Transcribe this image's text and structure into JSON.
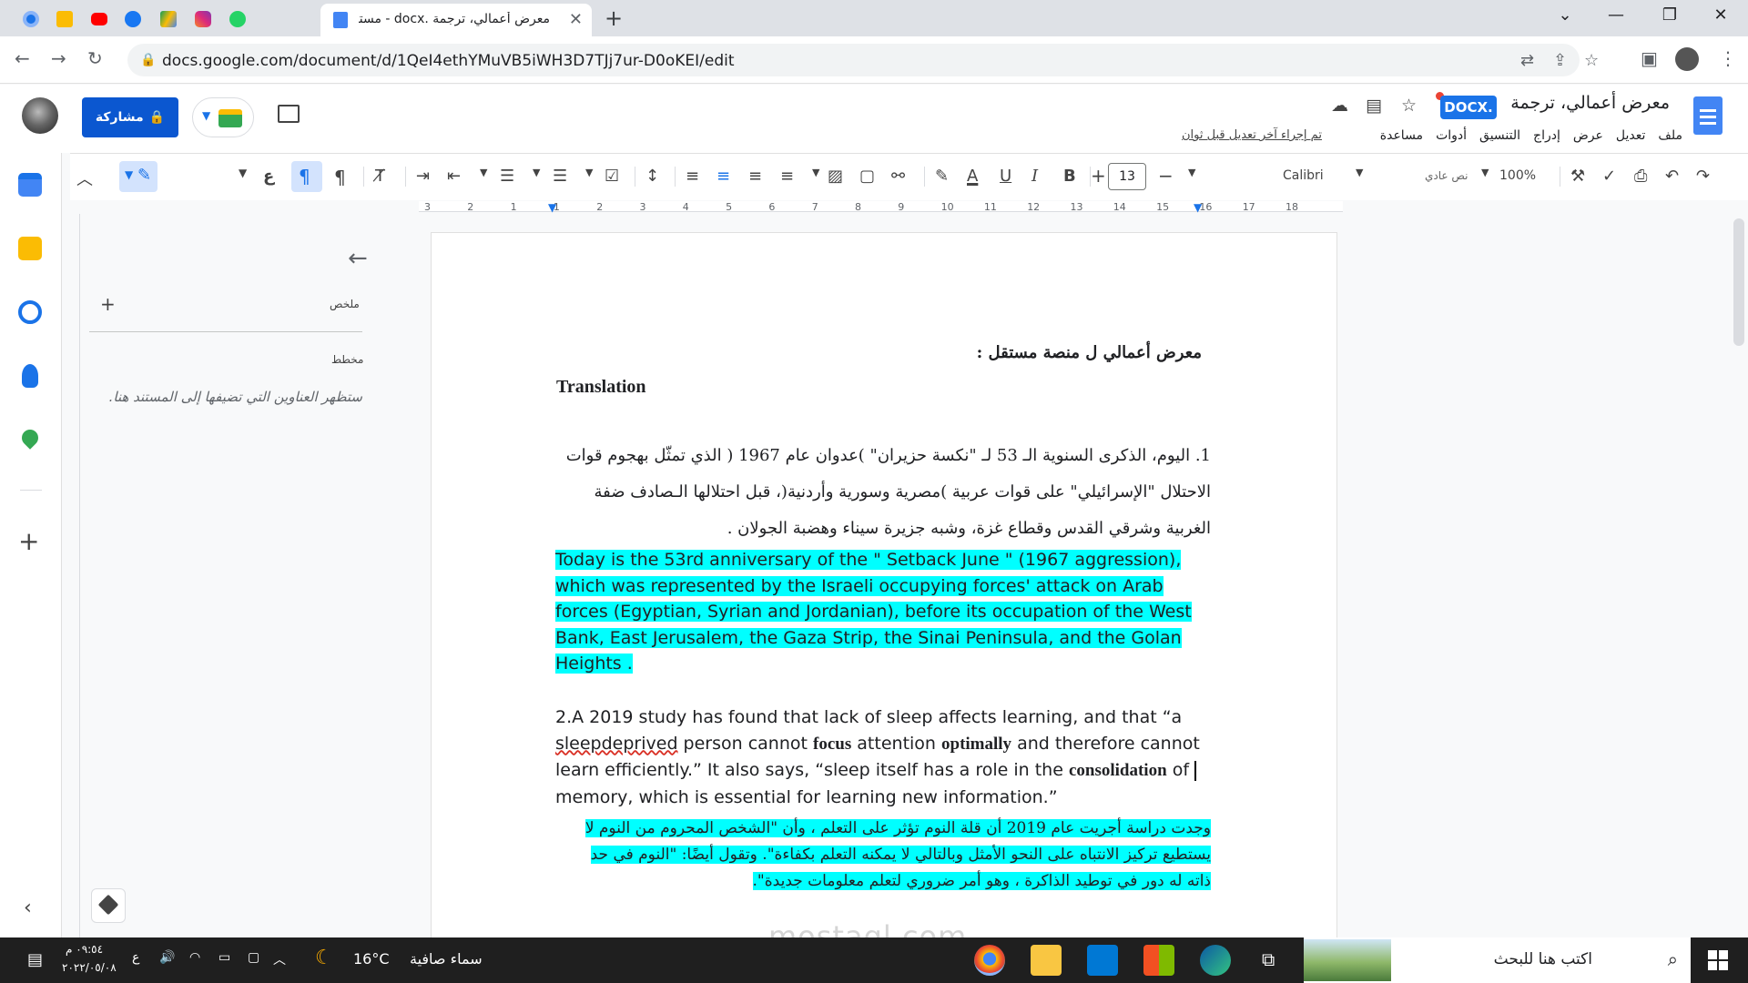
{
  "browser": {
    "active_tab_title": "معرض أعمالي، ترجمة .docx - مستن",
    "url": "docs.google.com/document/d/1QeI4ethYMuVB5iWH3D7TJj7ur-D0oKEI/edit"
  },
  "docs_header": {
    "title": "معرض أعمالي، ترجمة",
    "badge": "DOCX.",
    "share_label": "مشاركة",
    "last_edit": "تم إجراء آخر تعديل قبل ثوان",
    "menu": [
      "ملف",
      "تعديل",
      "عرض",
      "إدراج",
      "التنسيق",
      "أدوات",
      "مساعدة"
    ]
  },
  "toolbar": {
    "font_size": "13",
    "font_name": "Calibri",
    "style": "نص عادي",
    "zoom": "100%",
    "input_tool": "ع"
  },
  "ruler": {
    "numbers": [
      "3",
      "2",
      "1",
      "1",
      "2",
      "3",
      "4",
      "5",
      "6",
      "7",
      "8",
      "9",
      "10",
      "11",
      "12",
      "13",
      "14",
      "15",
      "16",
      "17",
      "18"
    ]
  },
  "outline": {
    "summary_label": "ملخص",
    "outline_label": "مخطط",
    "empty_text": "ستظهر العناوين التي تضيفها إلى المستند هنا."
  },
  "document": {
    "heading": "معرض أعمالي ل منصة مستقل :",
    "translation": "Translation",
    "arabic_1": "1. اليوم، الذكرى السنوية الـ 53 لـ \"نكسة حزيران\" )عدوان عام 1967 ( الذي تمثّل بهجوم قوات الاحتلال \"الإسرائيلي\" على قوات عربية )مصرية وسورية وأردنية(، قبل احتلالها الـصادف ضفة الغربية وشرقي القدس وقطاع غزة، وشبه جزيرة سيناء وهضبة الجولان .",
    "english_1": " Today is the 53rd anniversary of the \" Setback June \" (1967 aggression), which was represented by the Israeli occupying  forces' attack on Arab forces (Egyptian, Syrian and Jordanian), before its occupation of the West Bank, East Jerusalem, the Gaza Strip, the Sinai Peninsula, and the Golan Heights  .",
    "english_2": {
      "a": "2.A 2019 study has found that lack of sleep affects learning,  and that  “a ",
      "b": "sleepdeprived",
      "c": " person cannot ",
      "d": "focus",
      "e": " attention ",
      "f": "optimally",
      "g": " and therefore cannot learn efficiently.” It also says, “sleep itself has a role in the ",
      "h": "consolidation",
      "i": " of ",
      "j": "memory, which is essential for learning new information.”"
    },
    "arabic_2": "وجدت دراسة أجريت عام 2019 أن قلة النوم تؤثر على التعلم ، وأن \"الشخص المحروم من النوم لا يستطيع تركيز الانتباه على النحو الأمثل وبالتالي لا يمكنه التعلم بكفاءة\". وتقول أيضًا: \"النوم في حد ذاته له دور في توطيد الذاكرة ، وهو أمر ضروري لتعلم معلومات جديدة\"."
  },
  "watermark": "mostaql.com",
  "taskbar": {
    "search_text": "اكتب هنا للبحث",
    "weather": "سماء صافية",
    "temperature": "16°C",
    "time": "٠٩:٥٤ م",
    "date": "٢٠٢٢/٠٥/٠٨",
    "lang": "ع"
  },
  "colors": {
    "highlight": "#00ffff",
    "share_button": "#0b57d0",
    "docs_blue": "#4285f4"
  }
}
